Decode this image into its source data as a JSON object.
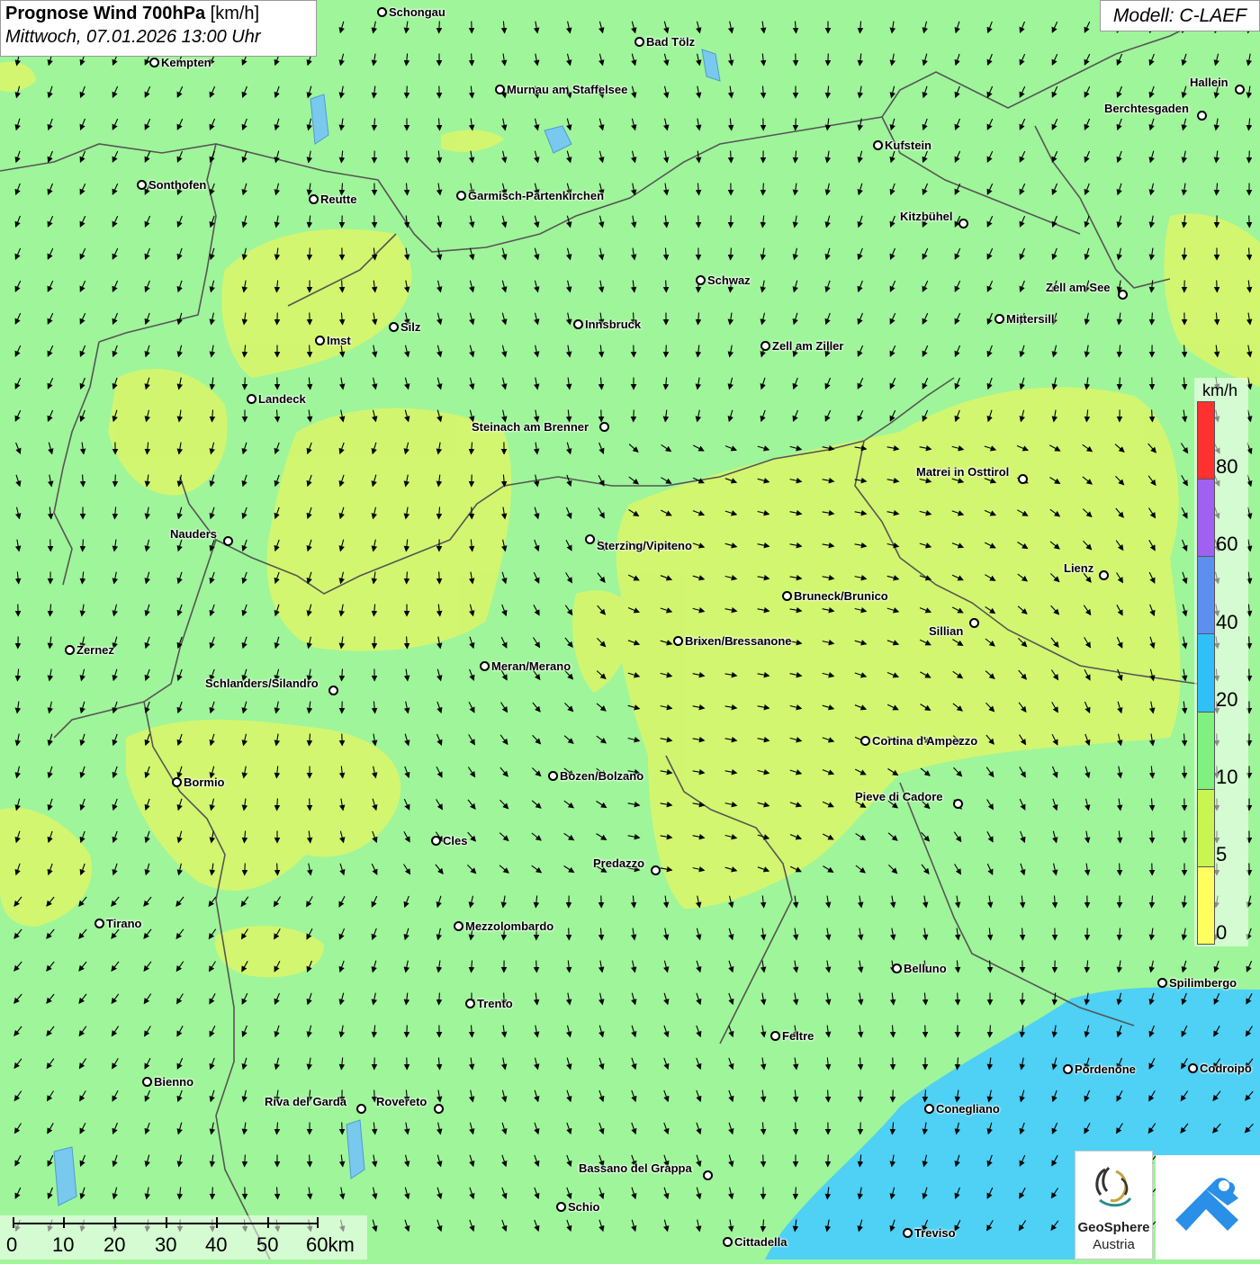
{
  "title": {
    "bold": "Prognose Wind 700hPa",
    "unit": "[km/h]",
    "datetime": "Mittwoch, 07.01.2026 13:00 Uhr"
  },
  "model": "Modell: C-LAEF",
  "legend": {
    "unit": "km/h",
    "ticks": [
      "80",
      "60",
      "40",
      "20",
      "10",
      "5",
      "0"
    ],
    "colors": [
      "#ff3030",
      "#a060f0",
      "#5c8ff0",
      "#30c0f8",
      "#80f080",
      "#c8f550",
      "#ffff60"
    ]
  },
  "scale": {
    "labels": [
      "0",
      "10",
      "20",
      "30",
      "40",
      "50",
      "60km"
    ]
  },
  "logos": {
    "geosphere_line1": "GeoSphere",
    "geosphere_line2": "Austria",
    "geosphere_icon": "geosphere-austria-logo-icon",
    "weather_icon": "weather-app-logo-icon"
  },
  "colors": {
    "wind_5_10": "#d5f56e",
    "wind_10_20": "#9ff59a",
    "wind_20_40": "#4fd0f5",
    "borders": "#555555"
  },
  "cities": [
    {
      "id": "schongau",
      "name": "Schongau"
    },
    {
      "id": "kempten",
      "name": "Kempten"
    },
    {
      "id": "bad-toelz",
      "name": "Bad Tölz"
    },
    {
      "id": "murnau",
      "name": "Murnau am Staffelsee"
    },
    {
      "id": "hallein",
      "name": "Hallein"
    },
    {
      "id": "berchtesgaden",
      "name": "Berchtesgaden"
    },
    {
      "id": "kufstein",
      "name": "Kufstein"
    },
    {
      "id": "sonthofen",
      "name": "Sonthofen"
    },
    {
      "id": "reutte",
      "name": "Reutte"
    },
    {
      "id": "garmisch",
      "name": "Garmisch-Partenkirchen"
    },
    {
      "id": "kitzbuehel",
      "name": "Kitzbühel"
    },
    {
      "id": "schwaz",
      "name": "Schwaz"
    },
    {
      "id": "zell-am-see",
      "name": "Zell am See"
    },
    {
      "id": "mittersill",
      "name": "Mittersill"
    },
    {
      "id": "imst",
      "name": "Imst"
    },
    {
      "id": "silz",
      "name": "Silz"
    },
    {
      "id": "innsbruck",
      "name": "Innsbruck"
    },
    {
      "id": "zell-am-ziller",
      "name": "Zell am Ziller"
    },
    {
      "id": "landeck",
      "name": "Landeck"
    },
    {
      "id": "steinach",
      "name": "Steinach am Brenner"
    },
    {
      "id": "matrei",
      "name": "Matrei in Osttirol"
    },
    {
      "id": "nauders",
      "name": "Nauders"
    },
    {
      "id": "sterzing",
      "name": "Sterzing/Vipiteno"
    },
    {
      "id": "lienz",
      "name": "Lienz"
    },
    {
      "id": "bruneck",
      "name": "Bruneck/Brunico"
    },
    {
      "id": "sillian",
      "name": "Sillian"
    },
    {
      "id": "zernez",
      "name": "Zernez"
    },
    {
      "id": "brixen",
      "name": "Brixen/Bressanone"
    },
    {
      "id": "meran",
      "name": "Meran/Merano"
    },
    {
      "id": "schlanders",
      "name": "Schlanders/Silandro"
    },
    {
      "id": "cortina",
      "name": "Cortina d'Ampezzo"
    },
    {
      "id": "bormio",
      "name": "Bormio"
    },
    {
      "id": "bozen",
      "name": "Bozen/Bolzano"
    },
    {
      "id": "pieve",
      "name": "Pieve di Cadore"
    },
    {
      "id": "cles",
      "name": "Cles"
    },
    {
      "id": "predazzo",
      "name": "Predazzo"
    },
    {
      "id": "tirano",
      "name": "Tirano"
    },
    {
      "id": "mezzolombardo",
      "name": "Mezzolombardo"
    },
    {
      "id": "belluno",
      "name": "Belluno"
    },
    {
      "id": "spilimbergo",
      "name": "Spilimbergo"
    },
    {
      "id": "trento",
      "name": "Trento"
    },
    {
      "id": "feltre",
      "name": "Feltre"
    },
    {
      "id": "pordenone",
      "name": "Pordenone"
    },
    {
      "id": "codroipo",
      "name": "Codroipo"
    },
    {
      "id": "bienno",
      "name": "Bienno"
    },
    {
      "id": "riva",
      "name": "Riva del Garda"
    },
    {
      "id": "rovereto",
      "name": "Rovereto"
    },
    {
      "id": "conegliano",
      "name": "Conegliano"
    },
    {
      "id": "bassano",
      "name": "Bassano del Grappa"
    },
    {
      "id": "schio",
      "name": "Schio"
    },
    {
      "id": "treviso",
      "name": "Treviso"
    },
    {
      "id": "cittadella",
      "name": "Cittadella"
    }
  ]
}
